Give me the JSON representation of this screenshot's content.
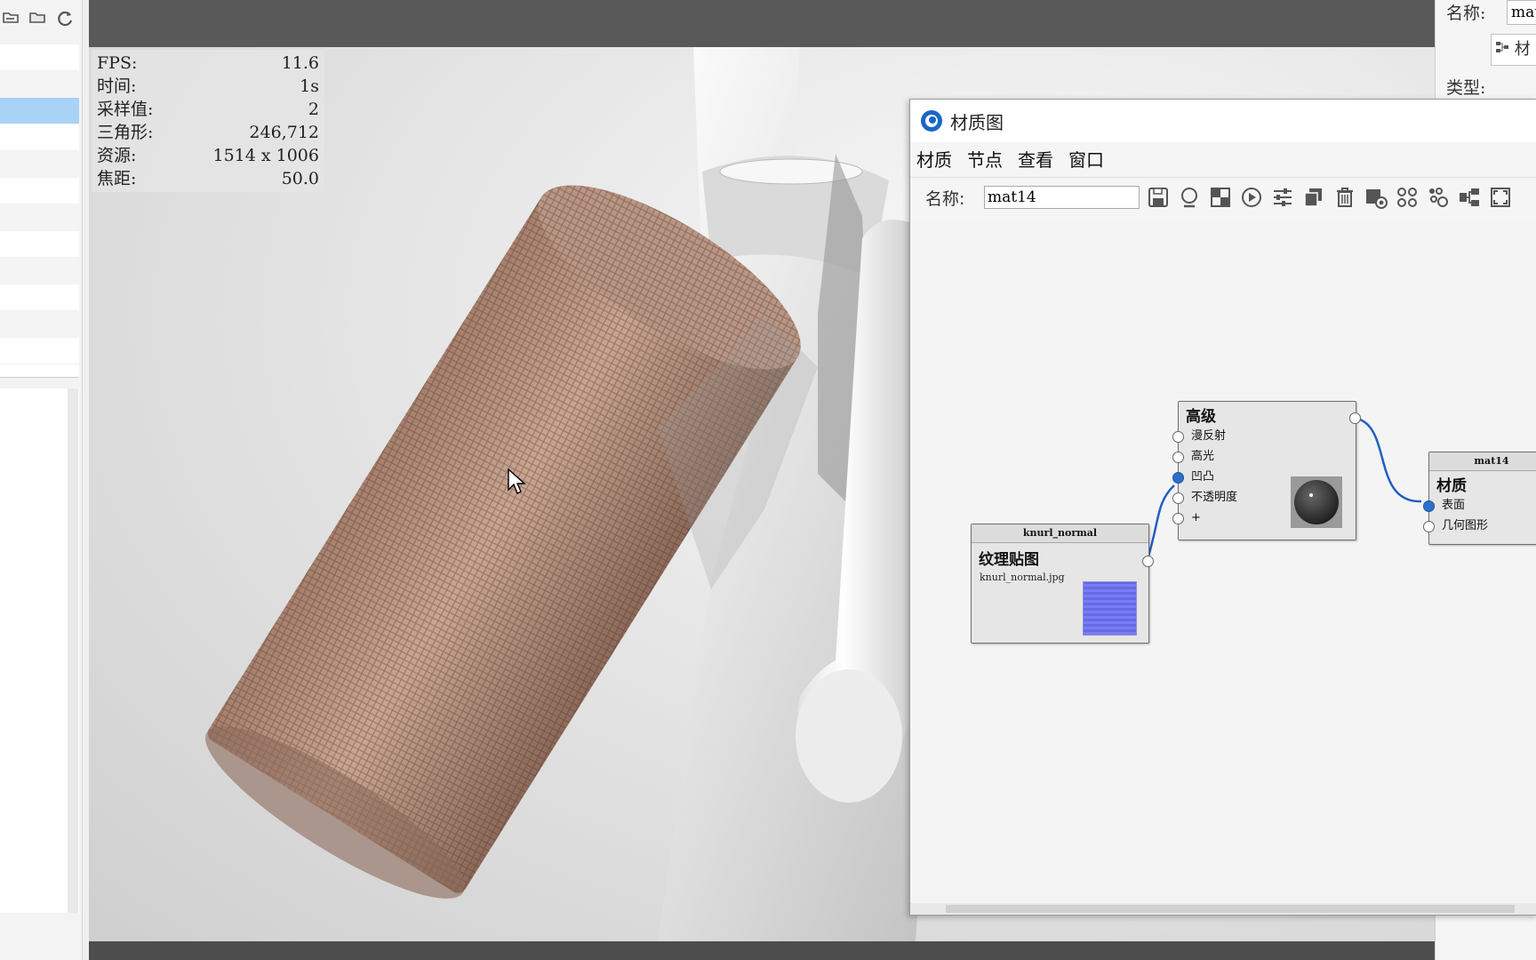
{
  "left_panel": {
    "toolbar_icons": [
      "open-folder-icon",
      "folder-icon",
      "refresh-icon"
    ],
    "rows": 12,
    "selected_row": 2
  },
  "viewport": {
    "stats": [
      {
        "label": "FPS:",
        "value": "11.6"
      },
      {
        "label": "时间:",
        "value": "1s"
      },
      {
        "label": "采样值:",
        "value": "2"
      },
      {
        "label": "三角形:",
        "value": "246,712"
      },
      {
        "label": "资源:",
        "value": "1514 x 1006"
      },
      {
        "label": "焦距:",
        "value": "50.0"
      }
    ]
  },
  "right_panel": {
    "name_label": "名称:",
    "name_value": "mat",
    "mat_button": "材",
    "type_label": "类型:"
  },
  "material_graph": {
    "title": "材质图",
    "menus": [
      "材质",
      "节点",
      "查看",
      "窗口"
    ],
    "name_label": "名称:",
    "name_value": "mat14",
    "toolbar_icons": [
      "save-icon",
      "sphere-preview-icon",
      "checker-icon",
      "play-icon",
      "sliders-icon",
      "duplicate-icon",
      "delete-icon",
      "add-node-icon",
      "node-group-icon",
      "node-arrange-icon",
      "layout-icon",
      "fit-view-icon"
    ],
    "nodes": {
      "texture": {
        "header": "knurl_normal",
        "title": "纹理贴图",
        "file": "knurl_normal.jpg"
      },
      "advanced": {
        "title": "高级",
        "ports": [
          "漫反射",
          "高光",
          "凹凸",
          "不透明度",
          "+"
        ]
      },
      "material": {
        "header": "mat14",
        "title": "材质",
        "ports": [
          "表面",
          "几何图形"
        ]
      }
    }
  }
}
